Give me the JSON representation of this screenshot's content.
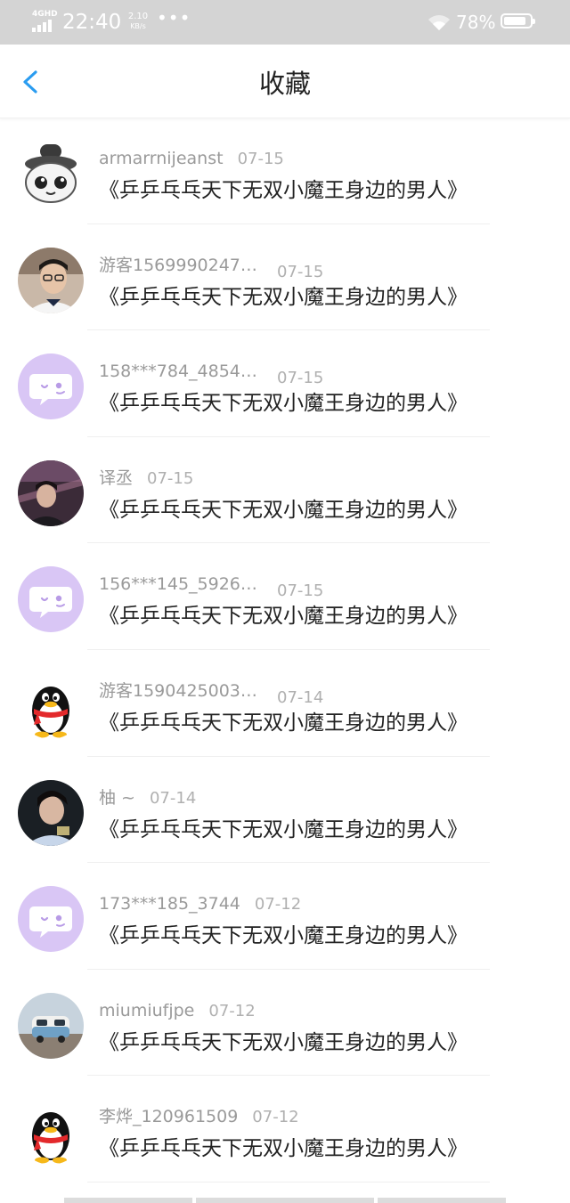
{
  "status_bar": {
    "network": "4GHD",
    "time": "22:40",
    "speed_value": "2.10",
    "speed_unit": "KB/s",
    "more": "•••",
    "battery_percent": "78%"
  },
  "nav": {
    "back_icon": "chevron-left-icon",
    "title": "收藏",
    "accent_color": "#2a9cf0"
  },
  "items": [
    {
      "name": "armarrnijeanst",
      "date": "07-15",
      "title": "《乒乒乓乓天下无双小魔王身边的男人》",
      "avatar": "cartoon-hat-avatar"
    },
    {
      "name": "游客1569990247…",
      "date": "07-15",
      "title": "《乒乒乓乓天下无双小魔王身边的男人》",
      "avatar": "photo-boy-glasses-avatar"
    },
    {
      "name": "158***784_4854…",
      "date": "07-15",
      "title": "《乒乒乓乓天下无双小魔王身边的男人》",
      "avatar": "purple-chat-bubble-avatar"
    },
    {
      "name": "译丞",
      "date": "07-15",
      "title": "《乒乒乓乓天下无双小魔王身边的男人》",
      "avatar": "photo-boy-stage-avatar"
    },
    {
      "name": "156***145_5926…",
      "date": "07-15",
      "title": "《乒乒乓乓天下无双小魔王身边的男人》",
      "avatar": "purple-chat-bubble-avatar"
    },
    {
      "name": "游客1590425003…",
      "date": "07-14",
      "title": "《乒乒乓乓天下无双小魔王身边的男人》",
      "avatar": "qq-penguin-avatar"
    },
    {
      "name": "柚 ~",
      "date": "07-14",
      "title": "《乒乒乓乓天下无双小魔王身边的男人》",
      "avatar": "photo-boy-dark-avatar"
    },
    {
      "name": "173***185_3744",
      "date": "07-12",
      "title": "《乒乒乓乓天下无双小魔王身边的男人》",
      "avatar": "purple-chat-bubble-avatar"
    },
    {
      "name": "miumiufjpe",
      "date": "07-12",
      "title": "《乒乒乓乓天下无双小魔王身边的男人》",
      "avatar": "photo-van-avatar"
    },
    {
      "name": "李烨_120961509",
      "date": "07-12",
      "title": "《乒乒乓乓天下无双小魔王身边的男人》",
      "avatar": "qq-penguin-avatar"
    }
  ],
  "colors": {
    "status_bar_bg": "#d4d4d4",
    "placeholder_avatar": "#d9c6f5"
  }
}
